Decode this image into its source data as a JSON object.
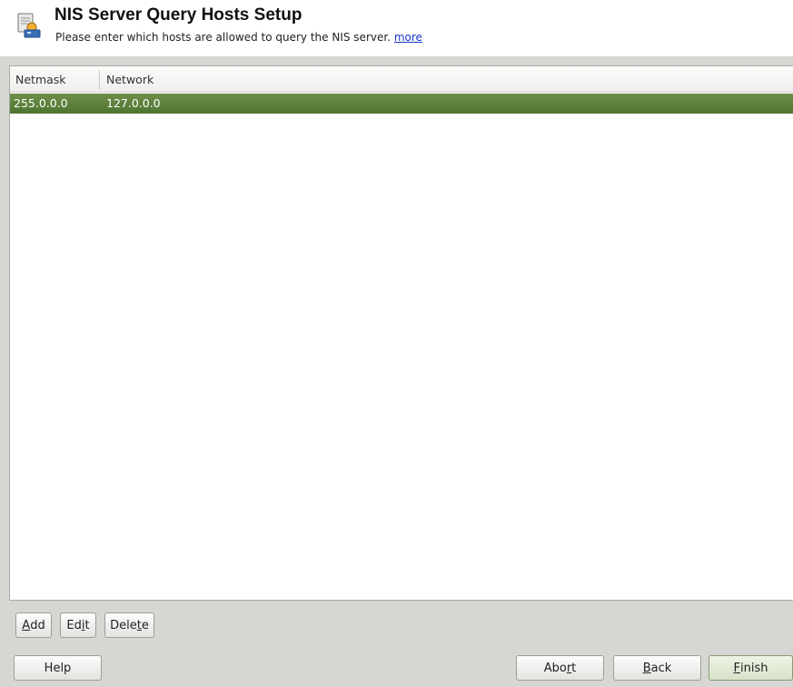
{
  "header": {
    "title": "NIS Server Query Hosts Setup",
    "subtitle": "Please enter which hosts are allowed to query the NIS server.",
    "more_link": "more"
  },
  "table": {
    "columns": [
      "Netmask",
      "Network"
    ],
    "rows": [
      {
        "netmask": "255.0.0.0",
        "network": "127.0.0.0",
        "selected": true
      }
    ]
  },
  "actions": {
    "add": {
      "pre": "",
      "mnemonic": "A",
      "post": "dd"
    },
    "edit": {
      "pre": "Ed",
      "mnemonic": "i",
      "post": "t"
    },
    "delete": {
      "pre": "Dele",
      "mnemonic": "t",
      "post": "e"
    }
  },
  "footer": {
    "help": "Help",
    "abort": {
      "pre": "Abo",
      "mnemonic": "r",
      "post": "t"
    },
    "back": {
      "pre": "",
      "mnemonic": "B",
      "post": "ack"
    },
    "finish": {
      "pre": "",
      "mnemonic": "F",
      "post": "inish"
    }
  },
  "colors": {
    "selection": "#5a7d3a",
    "panel": "#d6d6d3",
    "link": "#1a35c8"
  }
}
